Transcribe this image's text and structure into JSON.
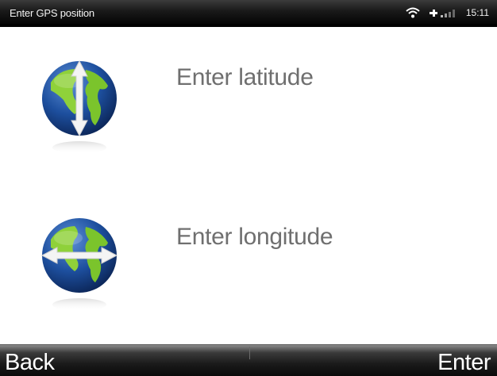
{
  "status_bar": {
    "title": "Enter GPS position",
    "time": "15:11",
    "icons": [
      "wifi-icon",
      "signal-icon"
    ]
  },
  "options": [
    {
      "label": "Enter latitude",
      "icon": "globe-latitude-icon"
    },
    {
      "label": "Enter longitude",
      "icon": "globe-longitude-icon"
    }
  ],
  "softkeys": {
    "left": "Back",
    "right": "Enter"
  },
  "colors": {
    "ocean": "#1d4f9e",
    "land": "#8fd13a",
    "label": "#6f6f6f",
    "bar": "#111111"
  }
}
